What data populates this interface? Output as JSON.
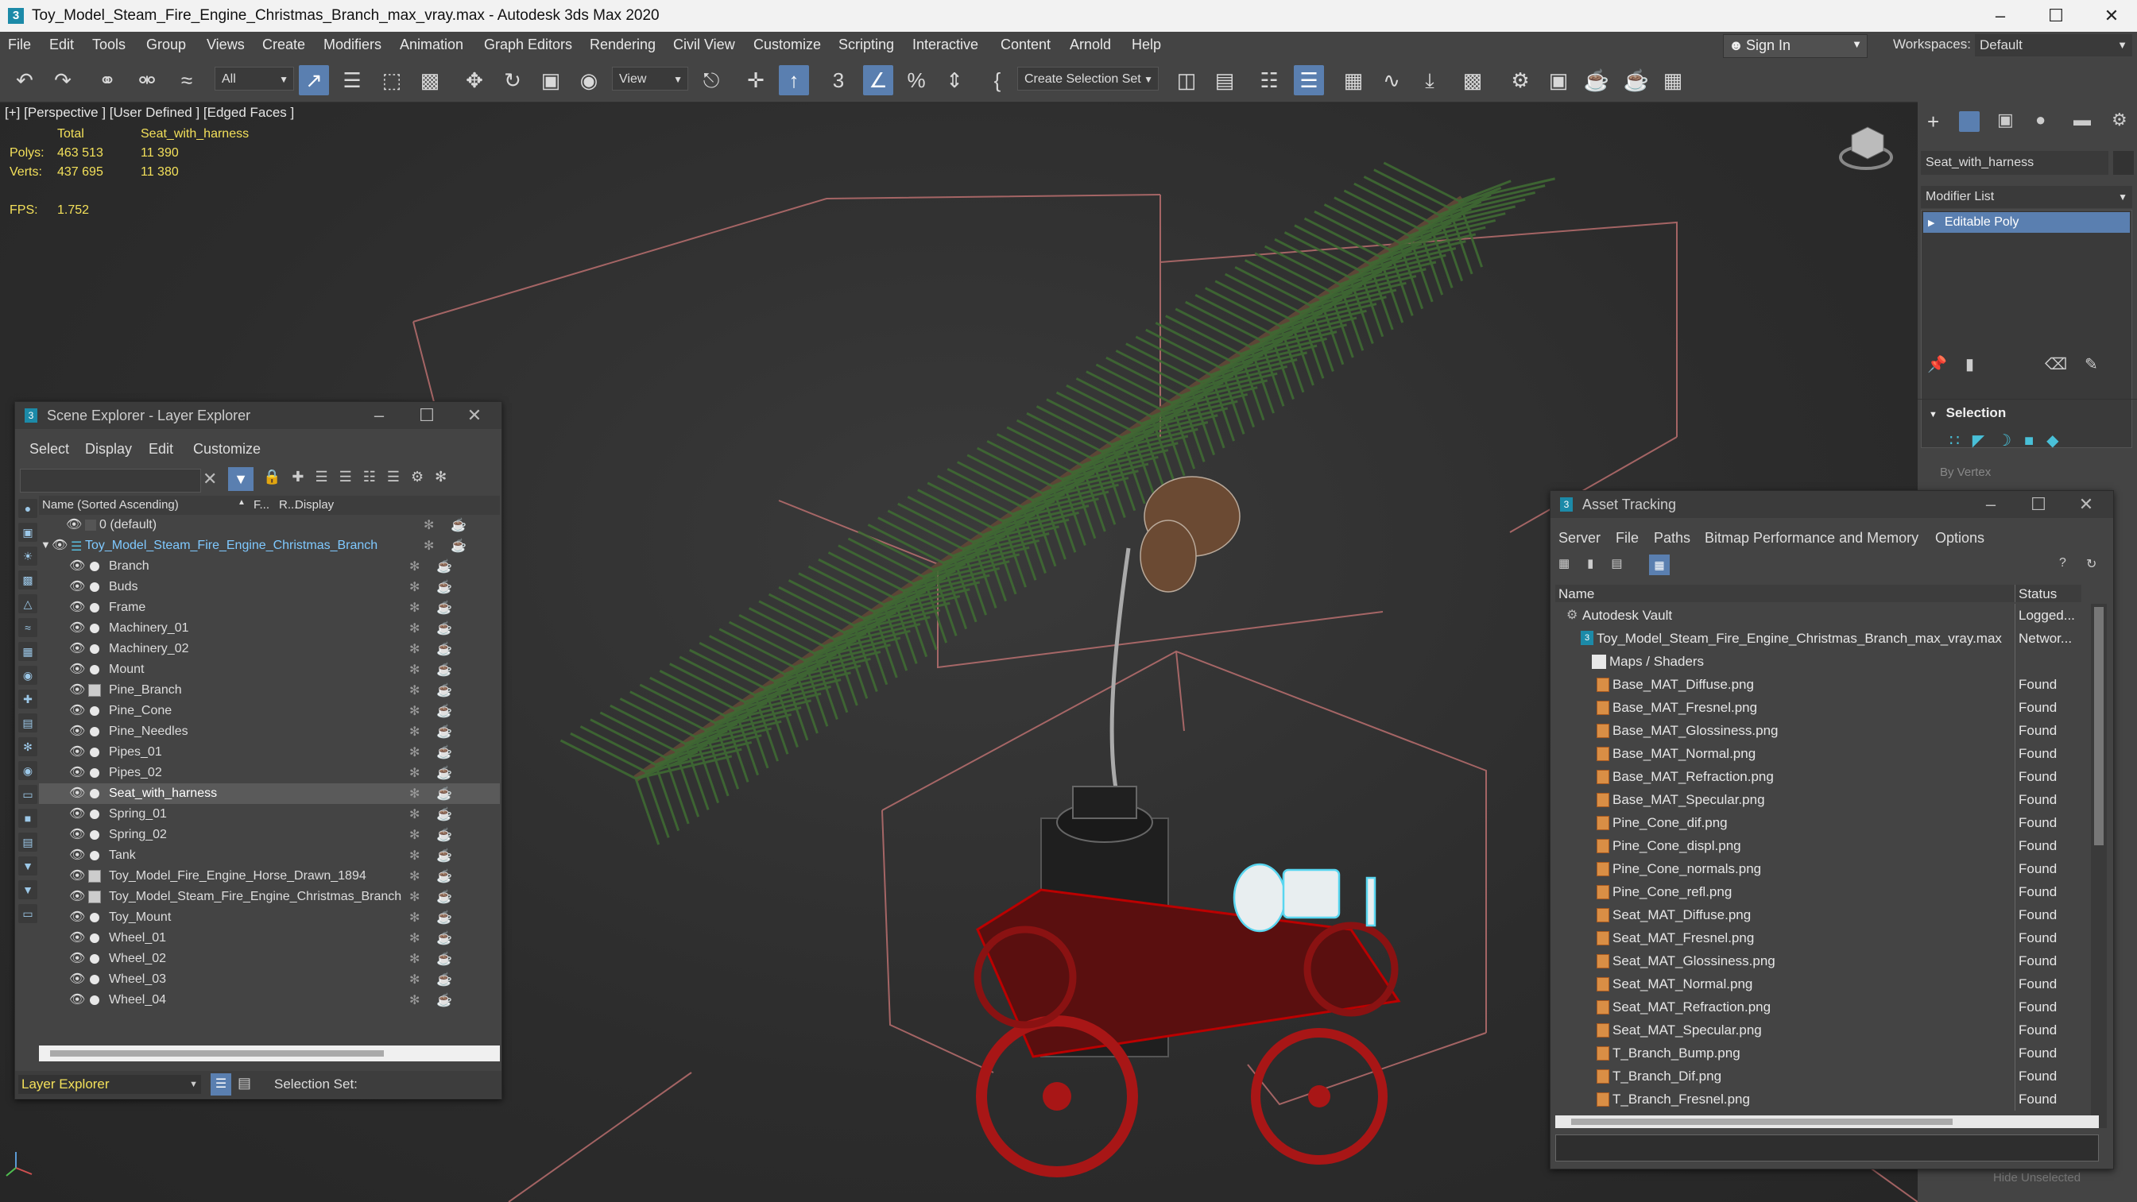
{
  "window": {
    "title": "Toy_Model_Steam_Fire_Engine_Christmas_Branch_max_vray.max - Autodesk 3ds Max 2020",
    "app_icon": "3"
  },
  "menubar": [
    "File",
    "Edit",
    "Tools",
    "Group",
    "Views",
    "Create",
    "Modifiers",
    "Animation",
    "Graph Editors",
    "Rendering",
    "Civil View",
    "Customize",
    "Scripting",
    "Interactive",
    "Content",
    "Arnold",
    "Help"
  ],
  "account": {
    "signin": "Sign In",
    "workspaces_label": "Workspaces:",
    "workspace": "Default"
  },
  "toolbar": {
    "filter": "All",
    "refcoord": "View",
    "selection_set": "Create Selection Set"
  },
  "viewport": {
    "label": "[+] [Perspective ] [User Defined ] [Edged Faces ]",
    "stats": {
      "col_total": "Total",
      "col_sel": "Seat_with_harness",
      "polys_label": "Polys:",
      "polys_total": "463 513",
      "polys_sel": "11 390",
      "verts_label": "Verts:",
      "verts_total": "437 695",
      "verts_sel": "11 380",
      "fps_label": "FPS:",
      "fps": "1.752"
    }
  },
  "command_panel": {
    "object_name": "Seat_with_harness",
    "modifier_list": "Modifier List",
    "stack_item": "Editable Poly",
    "rollout": "Selection",
    "by_vertex": "By Vertex",
    "hide_unselected": "Hide Unselected"
  },
  "scene_explorer": {
    "title": "Scene Explorer - Layer Explorer",
    "menu": [
      "Select",
      "Display",
      "Edit",
      "Customize"
    ],
    "columns": {
      "name": "Name (Sorted Ascending)",
      "f": "F...",
      "r": "R...",
      "display": "Display"
    },
    "default_layer": "0 (default)",
    "root": "Toy_Model_Steam_Fire_Engine_Christmas_Branch",
    "items": [
      "Branch",
      "Buds",
      "Frame",
      "Machinery_01",
      "Machinery_02",
      "Mount",
      "Pine_Branch",
      "Pine_Cone",
      "Pine_Needles",
      "Pipes_01",
      "Pipes_02",
      "Seat_with_harness",
      "Spring_01",
      "Spring_02",
      "Tank",
      "Toy_Model_Fire_Engine_Horse_Drawn_1894",
      "Toy_Model_Steam_Fire_Engine_Christmas_Branch",
      "Toy_Mount",
      "Wheel_01",
      "Wheel_02",
      "Wheel_03",
      "Wheel_04"
    ],
    "selected": "Seat_with_harness",
    "footer_mode": "Layer Explorer",
    "selection_set_label": "Selection Set:"
  },
  "asset_tracking": {
    "title": "Asset Tracking",
    "menu": [
      "Server",
      "File",
      "Paths",
      "Bitmap Performance and Memory",
      "Options"
    ],
    "columns": {
      "name": "Name",
      "status": "Status"
    },
    "vault": {
      "name": "Autodesk Vault",
      "status": "Logged..."
    },
    "file": {
      "name": "Toy_Model_Steam_Fire_Engine_Christmas_Branch_max_vray.max",
      "status": "Networ..."
    },
    "group": "Maps / Shaders",
    "files": [
      {
        "name": "Base_MAT_Diffuse.png",
        "status": "Found"
      },
      {
        "name": "Base_MAT_Fresnel.png",
        "status": "Found"
      },
      {
        "name": "Base_MAT_Glossiness.png",
        "status": "Found"
      },
      {
        "name": "Base_MAT_Normal.png",
        "status": "Found"
      },
      {
        "name": "Base_MAT_Refraction.png",
        "status": "Found"
      },
      {
        "name": "Base_MAT_Specular.png",
        "status": "Found"
      },
      {
        "name": "Pine_Cone_dif.png",
        "status": "Found"
      },
      {
        "name": "Pine_Cone_displ.png",
        "status": "Found"
      },
      {
        "name": "Pine_Cone_normals.png",
        "status": "Found"
      },
      {
        "name": "Pine_Cone_refl.png",
        "status": "Found"
      },
      {
        "name": "Seat_MAT_Diffuse.png",
        "status": "Found"
      },
      {
        "name": "Seat_MAT_Fresnel.png",
        "status": "Found"
      },
      {
        "name": "Seat_MAT_Glossiness.png",
        "status": "Found"
      },
      {
        "name": "Seat_MAT_Normal.png",
        "status": "Found"
      },
      {
        "name": "Seat_MAT_Refraction.png",
        "status": "Found"
      },
      {
        "name": "Seat_MAT_Specular.png",
        "status": "Found"
      },
      {
        "name": "T_Branch_Bump.png",
        "status": "Found"
      },
      {
        "name": "T_Branch_Dif.png",
        "status": "Found"
      },
      {
        "name": "T_Branch_Fresnel.png",
        "status": "Found"
      }
    ]
  }
}
